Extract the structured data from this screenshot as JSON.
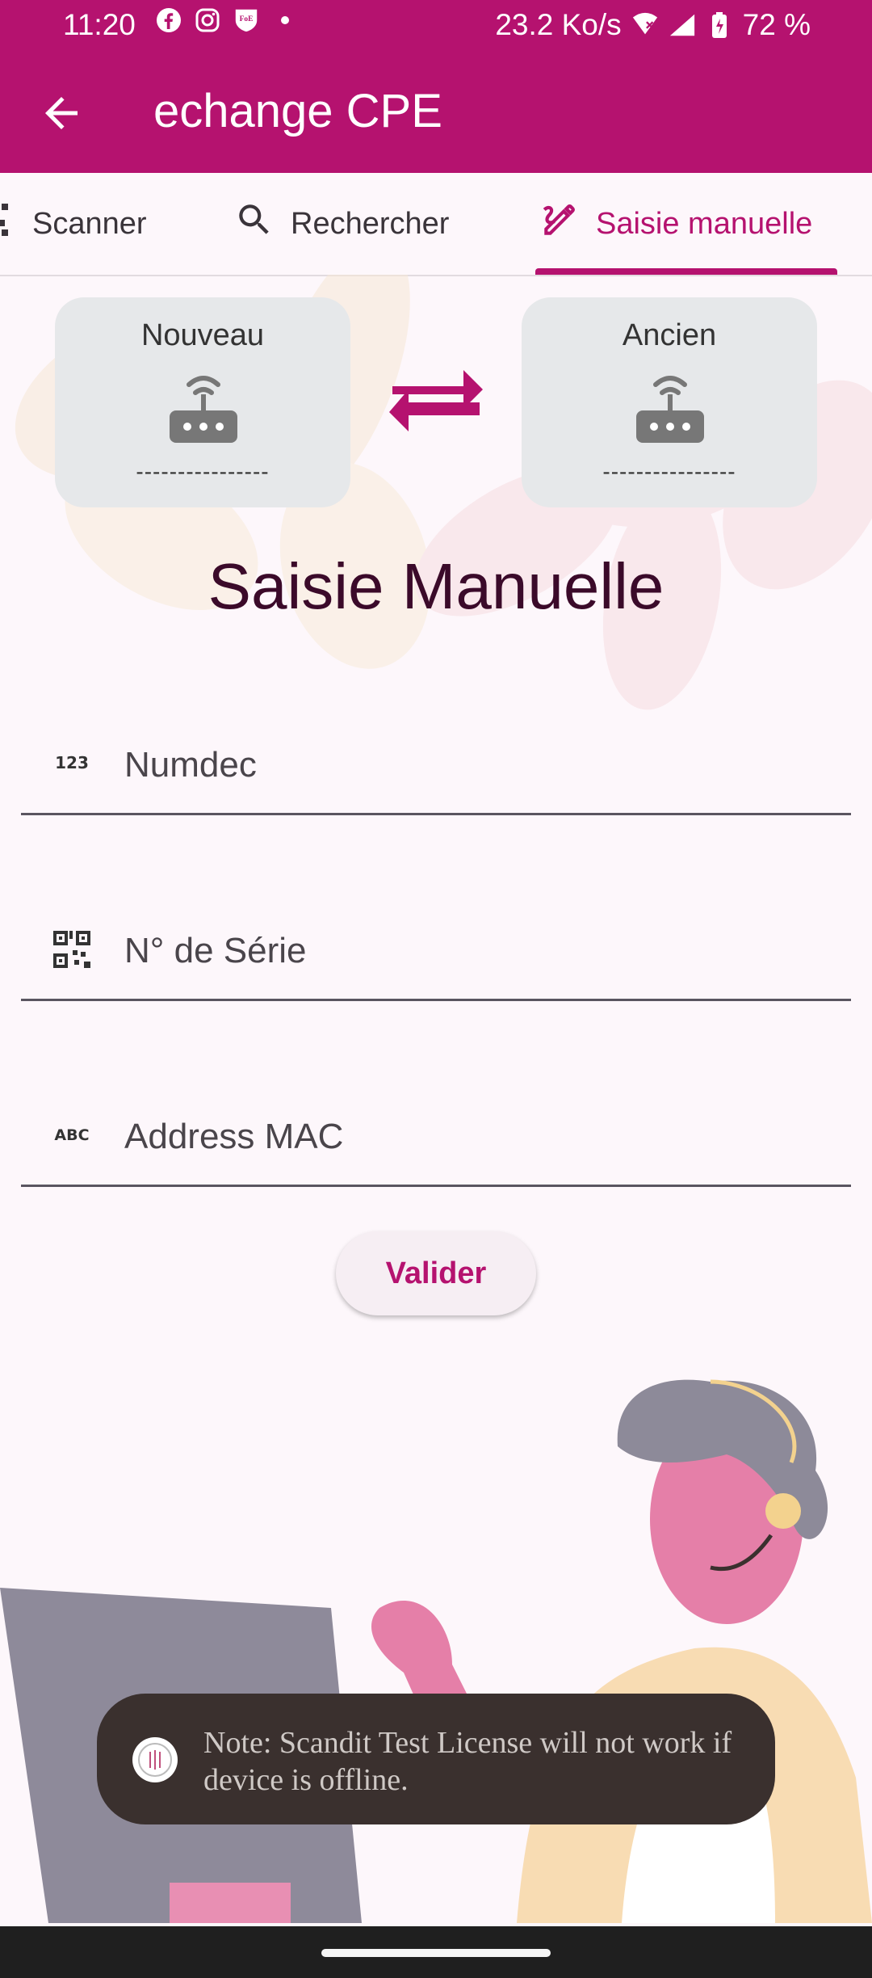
{
  "status_bar": {
    "time": "11:20",
    "speed": "23.2 Ko/s",
    "battery": "72 %",
    "icons": [
      "facebook-icon",
      "instagram-icon",
      "foe-shield-icon",
      "dot-icon",
      "wifi-icon",
      "signal-icon",
      "battery-icon"
    ]
  },
  "app_bar": {
    "title": "echange CPE",
    "back_icon": "arrow-back-icon",
    "background": "#b5126f"
  },
  "tabs": [
    {
      "label": "Scanner",
      "icon": "qr-code-icon",
      "active": false
    },
    {
      "label": "Rechercher",
      "icon": "search-icon",
      "active": false
    },
    {
      "label": "Saisie manuelle",
      "icon": "edit-pen-icon",
      "active": true
    }
  ],
  "devices": {
    "new": {
      "label": "Nouveau",
      "value": "----------------"
    },
    "old": {
      "label": "Ancien",
      "value": "----------------"
    },
    "swap_icon": "swap-arrows-icon"
  },
  "form": {
    "heading": "Saisie Manuelle",
    "fields": [
      {
        "placeholder": "Numdec",
        "icon": "numbers-123-icon",
        "value": ""
      },
      {
        "placeholder": "N° de Série",
        "icon": "qr-code-icon",
        "value": ""
      },
      {
        "placeholder": "Address MAC",
        "icon": "abc-icon",
        "value": ""
      }
    ],
    "submit_label": "Valider"
  },
  "toast": {
    "text": "Note: Scandit Test License will not work if device is offline."
  },
  "colors": {
    "accent": "#b5126f",
    "toast_bg": "#3a302e",
    "card_bg": "#e6e8ea"
  }
}
